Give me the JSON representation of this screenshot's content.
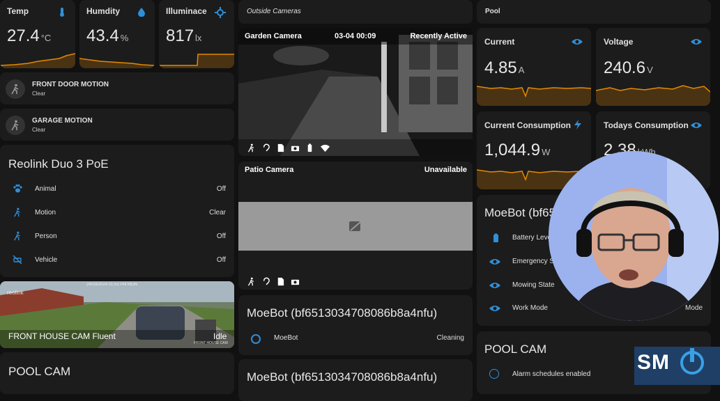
{
  "sensors": {
    "temp": {
      "label": "Temp",
      "value": "27.4",
      "unit": "°C"
    },
    "humidity": {
      "label": "Humdity",
      "value": "43.4",
      "unit": "%"
    },
    "illuminance": {
      "label": "Illuminace",
      "value": "817",
      "unit": "lx"
    }
  },
  "motion_tiles": [
    {
      "name": "FRONT DOOR MOTION",
      "state": "Clear"
    },
    {
      "name": "GARAGE MOTION",
      "state": "Clear"
    }
  ],
  "reolink": {
    "title": "Reolink Duo 3 PoE",
    "rows": [
      {
        "label": "Animal",
        "value": "Off"
      },
      {
        "label": "Motion",
        "value": "Clear"
      },
      {
        "label": "Person",
        "value": "Off"
      },
      {
        "label": "Vehicle",
        "value": "Off"
      }
    ]
  },
  "front_cam": {
    "name": "FRONT HOUSE CAM Fluent",
    "state": "Idle",
    "brand": "reolink",
    "stamp": "24/03/2024 01:53 PM MON",
    "corner": "FRONT HOUSE CAM"
  },
  "pool_cam_left": {
    "title": "POOL CAM"
  },
  "outside": {
    "title": "Outside Cameras"
  },
  "garden_cam": {
    "name": "Garden Camera",
    "time": "03-04 00:09",
    "status": "Recently Active"
  },
  "patio_cam": {
    "name": "Patio Camera",
    "status": "Unavailable"
  },
  "moebot_mid": {
    "title": "MoeBot (bf6513034708086b8a4nfu)",
    "row_label": "MoeBot",
    "row_value": "Cleaning"
  },
  "moebot_mid2": {
    "title": "MoeBot (bf6513034708086b8a4nfu)"
  },
  "pool": {
    "title": "Pool"
  },
  "current": {
    "label": "Current",
    "value": "4.85",
    "unit": "A"
  },
  "voltage": {
    "label": "Voltage",
    "value": "240.6",
    "unit": "V"
  },
  "consumption": {
    "label": "Current Consumption",
    "value": "1,044.9",
    "unit": "W"
  },
  "todays": {
    "label": "Todays Consumption",
    "value": "2.38",
    "unit": "kWh"
  },
  "moebot_right": {
    "title": "MoeBot (bf65",
    "rows": [
      {
        "label": "Battery Leve"
      },
      {
        "label": "Emergency St"
      },
      {
        "label": "Mowing State"
      },
      {
        "label": "Work Mode",
        "value": "Mode"
      }
    ]
  },
  "pool_cam_right": {
    "title": "POOL CAM",
    "row": "Alarm schedules enabled"
  },
  "logo": {
    "text": "SM"
  },
  "colors": {
    "accent": "#2f8fd8",
    "spark": "#e58a00",
    "card": "#1c1c1c"
  }
}
